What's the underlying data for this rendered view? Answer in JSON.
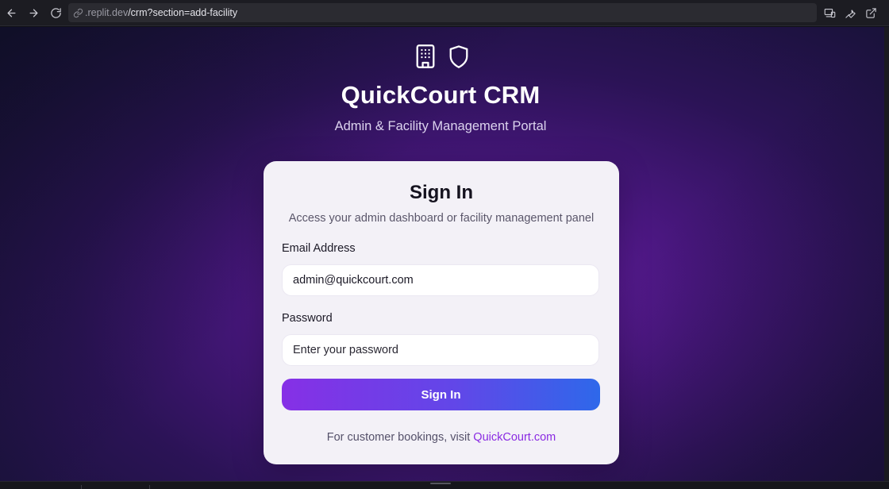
{
  "browser": {
    "url_domain": ".replit.dev",
    "url_path": "/crm?section=add-facility",
    "icons": {
      "back": "arrow-left-icon",
      "forward": "arrow-right-icon",
      "reload": "reload-icon",
      "link": "link-icon",
      "devices": "devices-icon",
      "tools": "wrench-icon",
      "external": "external-link-icon"
    }
  },
  "hero": {
    "icons": [
      "building-icon",
      "shield-icon"
    ],
    "title": "QuickCourt CRM",
    "subtitle": "Admin & Facility Management Portal"
  },
  "card": {
    "title": "Sign In",
    "subtitle": "Access your admin dashboard or facility management panel",
    "email": {
      "label": "Email Address",
      "value": "admin@quickcourt.com"
    },
    "password": {
      "label": "Password",
      "placeholder": "Enter your password"
    },
    "submit_label": "Sign In",
    "footer_text": "For customer bookings, visit ",
    "footer_link": "QuickCourt.com"
  },
  "colors": {
    "accent_purple": "#8630e6",
    "accent_blue": "#2e68ea",
    "link": "#8a2be2",
    "card_bg": "#f3f1f7"
  }
}
